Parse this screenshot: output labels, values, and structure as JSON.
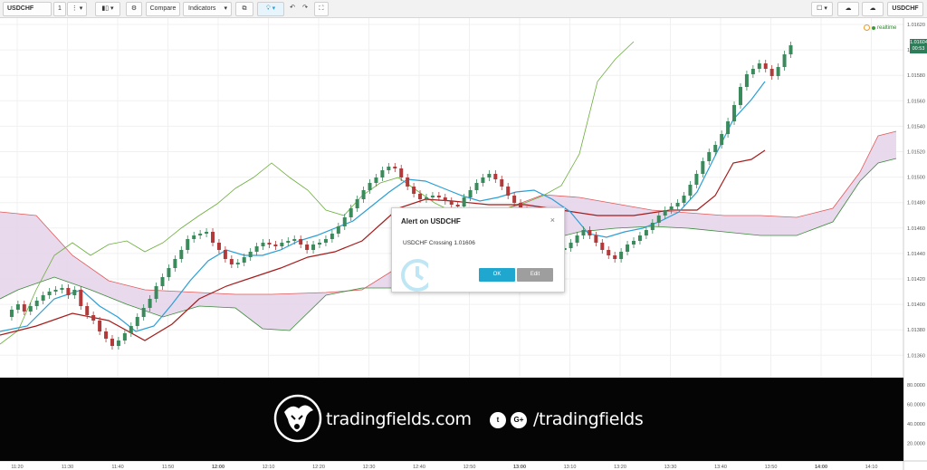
{
  "toolbar": {
    "symbol": "USDCHF",
    "interval": "1",
    "compare_label": "Compare",
    "indicators_label": "Indicators",
    "right_symbol": "USDCHF"
  },
  "chart": {
    "realtime_label": "realtime",
    "price_tag": "1.01604",
    "price_tag_time": "00:53",
    "price_axis": [
      "1.01620",
      "1.01600",
      "1.01580",
      "1.01560",
      "1.01540",
      "1.01520",
      "1.01500",
      "1.01480",
      "1.01460",
      "1.01440",
      "1.01420",
      "1.01400",
      "1.01380",
      "1.01360"
    ],
    "osc_axis": [
      "80.0000",
      "60.0000",
      "40.0000",
      "20.0000"
    ],
    "time_axis": [
      "11:20",
      "11:30",
      "11:40",
      "11:50",
      "12:00",
      "12:10",
      "12:20",
      "12:30",
      "12:40",
      "12:50",
      "13:00",
      "13:10",
      "13:20",
      "13:30",
      "13:40",
      "13:50",
      "14:00",
      "14:10"
    ],
    "colors": {
      "up": "#3a8a5c",
      "down": "#b23a3a",
      "tenkan": "#2a9fd6",
      "kijun": "#a61c1c",
      "chikou": "#6aad3a",
      "cloud": "#e6d5ea"
    }
  },
  "alert": {
    "title": "Alert on USDCHF",
    "message": "USDCHF Crossing 1.01606",
    "ok_label": "OK",
    "edit_label": "Edit",
    "close_glyph": "×"
  },
  "banner": {
    "brand": "tradingfields.com",
    "social": "/tradingfields",
    "twitter_glyph": "t",
    "google_glyph": "G+"
  }
}
